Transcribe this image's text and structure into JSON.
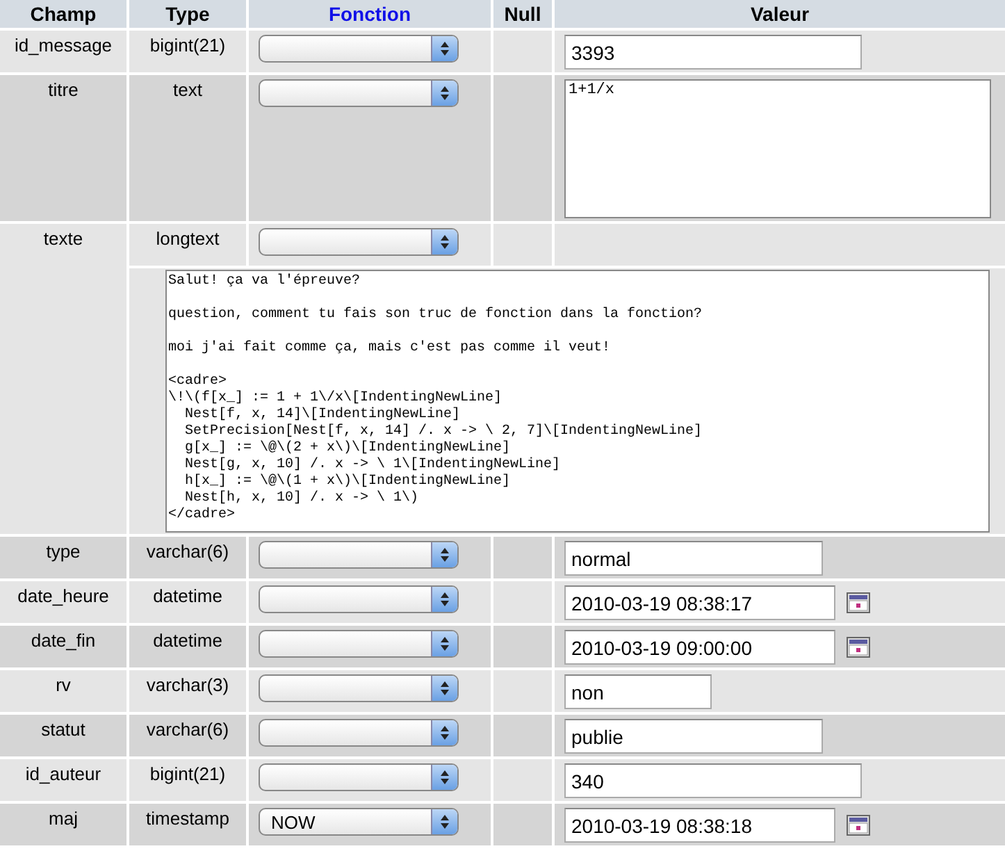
{
  "columns": [
    "Champ",
    "Type",
    "Fonction",
    "Null",
    "Valeur"
  ],
  "rows": [
    {
      "field": "id_message",
      "type": "bigint(21)",
      "function": "",
      "kind": "input",
      "value": "3393",
      "calendar": false
    },
    {
      "field": "titre",
      "type": "text",
      "function": "",
      "kind": "textarea",
      "value": "1+1/x",
      "calendar": false
    },
    {
      "field": "texte",
      "type": "longtext",
      "function": "",
      "kind": "longtext",
      "value": "Salut! ça va l'épreuve?\n\nquestion, comment tu fais son truc de fonction dans la fonction?\n\nmoi j'ai fait comme ça, mais c'est pas comme il veut!\n\n<cadre>\n\\!\\(f[x_] := 1 + 1\\/x\\[IndentingNewLine]\n  Nest[f, x, 14]\\[IndentingNewLine]\n  SetPrecision[Nest[f, x, 14] /. x -> \\ 2, 7]\\[IndentingNewLine]\n  g[x_] := \\@\\(2 + x\\)\\[IndentingNewLine]\n  Nest[g, x, 10] /. x -> \\ 1\\[IndentingNewLine]\n  h[x_] := \\@\\(1 + x\\)\\[IndentingNewLine]\n  Nest[h, x, 10] /. x -> \\ 1\\)\n</cadre>",
      "calendar": false
    },
    {
      "field": "type",
      "type": "varchar(6)",
      "function": "",
      "kind": "input",
      "value": "normal",
      "calendar": false
    },
    {
      "field": "date_heure",
      "type": "datetime",
      "function": "",
      "kind": "input",
      "value": "2010-03-19 08:38:17",
      "calendar": true
    },
    {
      "field": "date_fin",
      "type": "datetime",
      "function": "",
      "kind": "input",
      "value": "2010-03-19 09:00:00",
      "calendar": true
    },
    {
      "field": "rv",
      "type": "varchar(3)",
      "function": "",
      "kind": "input",
      "value": "non",
      "calendar": false
    },
    {
      "field": "statut",
      "type": "varchar(6)",
      "function": "",
      "kind": "input",
      "value": "publie",
      "calendar": false
    },
    {
      "field": "id_auteur",
      "type": "bigint(21)",
      "function": "",
      "kind": "input",
      "value": "340",
      "calendar": false
    },
    {
      "field": "maj",
      "type": "timestamp",
      "function": "NOW",
      "kind": "input",
      "value": "2010-03-19 08:38:18",
      "calendar": true
    }
  ]
}
